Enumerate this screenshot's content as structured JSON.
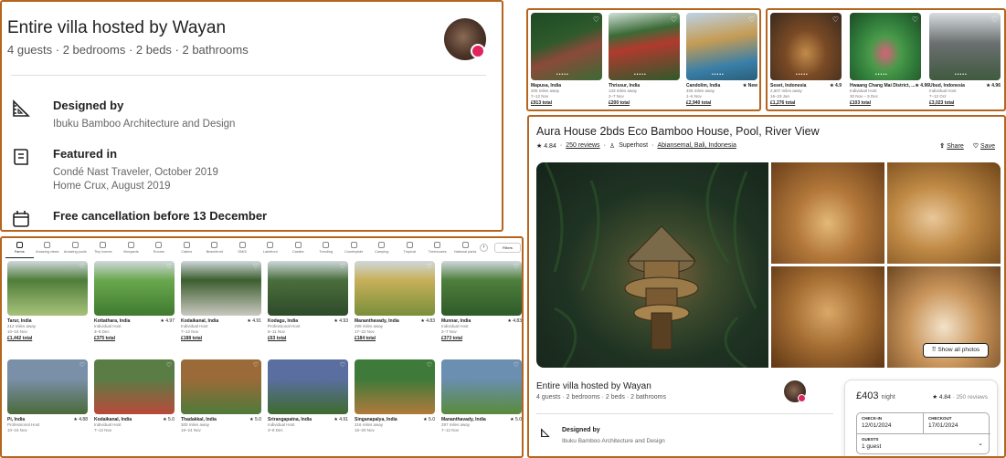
{
  "host_panel": {
    "title": "Entire villa hosted by Wayan",
    "subtitle": "4 guests · 2 bedrooms · 2 beds · 2 bathrooms",
    "features": [
      {
        "icon": "design-ruler-icon",
        "heading": "Designed by",
        "lines": [
          "Ibuku Bamboo Architecture and Design"
        ]
      },
      {
        "icon": "book-icon",
        "heading": "Featured in",
        "lines": [
          "Condé Nast Traveler, October 2019",
          "Home Crux, August 2019"
        ]
      },
      {
        "icon": "calendar-icon",
        "heading": "Free cancellation before 13 December",
        "lines": []
      }
    ]
  },
  "listing_panel_a": {
    "cards": [
      {
        "location": "Mapusa, India",
        "rating": "",
        "line2": "205 miles away",
        "line3": "7–12 Nov",
        "price": "£913 total",
        "color1": "#2e5a2c",
        "color2": "#8b4a3a"
      },
      {
        "location": "Thrissur, India",
        "rating": "",
        "line2": "133 miles away",
        "line3": "2–7 Nov",
        "price": "£200 total",
        "color1": "#3b6b36",
        "color2": "#b03a2e"
      },
      {
        "location": "Candolim, India",
        "rating": "★ New",
        "line2": "405 miles away",
        "line3": "1–6 Nov",
        "price": "£2,940 total",
        "color1": "#c59c55",
        "color2": "#3a7fa8"
      }
    ]
  },
  "listing_panel_b": {
    "cards": [
      {
        "location": "Seset, Indonesia",
        "rating": "★ 4.9",
        "line2": "2,607 miles away",
        "line3": "16–23 Jan",
        "price": "£1,276 total",
        "color1": "#3a2a1e",
        "color2": "#c28b4a"
      },
      {
        "location": "Hwaang Chang Mai District, ...",
        "rating": "★ 4.96",
        "line2": "Individual Host",
        "line3": "30 Nov – 5 Dec",
        "price": "£103 total",
        "color1": "#2f7a3a",
        "color2": "#d9607a"
      },
      {
        "location": "Ubud, Indonesia",
        "rating": "★ 4.96",
        "line2": "Individual Host",
        "line3": "7–12 Oct",
        "price": "£3,023 total",
        "color1": "#6b6f70",
        "color2": "#3f5a3e"
      }
    ]
  },
  "explore_grid": {
    "categories": [
      "Farms",
      "Amazing views",
      "Amazing pools",
      "Tiny homes",
      "Vineyards",
      "Rooms",
      "Cabins",
      "Beachfront",
      "OMG!",
      "Lakefront",
      "Castles",
      "Trending",
      "Countryside",
      "Camping",
      "Tropical",
      "Treehouses",
      "National parks"
    ],
    "filters_label": "Filters",
    "next_label": "›",
    "rows": [
      [
        {
          "location": "Tarur, India",
          "rating": "",
          "line2": "212 miles away",
          "line3": "10–15 Nov",
          "price": "£1,442 total",
          "color1": "#4f7d3a",
          "color2": "#a8c27a"
        },
        {
          "location": "Kottathara, India",
          "rating": "★ 4.97",
          "line2": "Individual Host",
          "line3": "3–8 Dec",
          "price": "£375 total",
          "color1": "#6aa84f",
          "color2": "#3f7a2f"
        },
        {
          "location": "Kodaikanal, India",
          "rating": "★ 4.91",
          "line2": "Individual Host",
          "line3": "7–12 Nov",
          "price": "£188 total",
          "color1": "#3c5e2e",
          "color2": "#c9c9c0"
        },
        {
          "location": "Kodagu, India",
          "rating": "★ 4.93",
          "line2": "Professional Host",
          "line3": "6–11 Nov",
          "price": "£63 total",
          "color1": "#4a6e3c",
          "color2": "#2e4a2a"
        },
        {
          "location": "Mananthavady, India",
          "rating": "★ 4.83",
          "line2": "299 miles away",
          "line3": "17–22 Nov",
          "price": "£184 total",
          "color1": "#c7b05a",
          "color2": "#7a8e3a"
        },
        {
          "location": "Munnar, India",
          "rating": "★ 4.83",
          "line2": "Individual Host",
          "line3": "2–7 Nov",
          "price": "£373 total",
          "color1": "#4e7f3c",
          "color2": "#2f5a2a"
        }
      ],
      [
        {
          "location": "Pi, India",
          "rating": "★ 4.88",
          "line2": "Professional Host",
          "line3": "10–15 Nov",
          "price": "",
          "color1": "#7a8fa8",
          "color2": "#4a6a3a"
        },
        {
          "location": "Kodaikanal, India",
          "rating": "★ 5.0",
          "line2": "Individual Host",
          "line3": "7–12 Nov",
          "price": "",
          "color1": "#5a7d45",
          "color2": "#b94a3a"
        },
        {
          "location": "Thadakkal, India",
          "rating": "★ 5.0",
          "line2": "300 miles away",
          "line3": "19–24 Nov",
          "price": "",
          "color1": "#9a6a38",
          "color2": "#4f7a3a"
        },
        {
          "location": "Srirangapatna, India",
          "rating": "★ 4.91",
          "line2": "Individual Host",
          "line3": "3–8 Dec",
          "price": "",
          "color1": "#5a6fa0",
          "color2": "#3e6a2e"
        },
        {
          "location": "Singanapalya, India",
          "rating": "★ 5.0",
          "line2": "216 miles away",
          "line3": "15–20 Nov",
          "price": "",
          "color1": "#3e7a3a",
          "color2": "#b07a3a"
        },
        {
          "location": "Mananthavady, India",
          "rating": "★ 5.0",
          "line2": "297 miles away",
          "line3": "7–12 Nov",
          "price": "",
          "color1": "#6a8fb0",
          "color2": "#5a8a3a"
        }
      ]
    ]
  },
  "listing_detail": {
    "title": "Aura House 2bds Eco Bamboo House, Pool, River View",
    "rating": "★ 4.84",
    "reviews": "250 reviews",
    "superhost": "Superhost",
    "location": "Abiansemal, Bali, Indonesia",
    "share_label": "Share",
    "save_label": "Save",
    "show_all_photos": "Show all photos",
    "host_heading": "Entire villa hosted by Wayan",
    "host_sub": "4 guests · 2 bedrooms · 2 beds · 2 bathrooms",
    "designed_heading": "Designed by",
    "designed_sub": "Ibuku Bamboo Architecture and Design",
    "booking": {
      "price": "£403",
      "price_unit": "night",
      "rating": "★ 4.84",
      "reviews": "· 250 reviews",
      "checkin_label": "CHECK-IN",
      "checkin_value": "12/01/2024",
      "checkout_label": "CHECKOUT",
      "checkout_value": "17/01/2024",
      "guests_label": "GUESTS",
      "guests_value": "1 guest"
    }
  }
}
